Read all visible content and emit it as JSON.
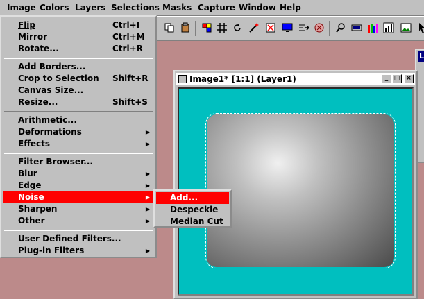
{
  "menubar": [
    {
      "label": "Image",
      "name": "menu-image",
      "active": true
    },
    {
      "label": "Colors",
      "name": "menu-colors"
    },
    {
      "label": "Layers",
      "name": "menu-layers"
    },
    {
      "label": "Selections",
      "name": "menu-selections"
    },
    {
      "label": "Masks",
      "name": "menu-masks"
    },
    {
      "label": "Capture",
      "name": "menu-capture"
    },
    {
      "label": "Window",
      "name": "menu-window"
    },
    {
      "label": "Help",
      "name": "menu-help"
    }
  ],
  "toolbar_icons": [
    "copy-icon",
    "paste-icon",
    "lock-icon",
    "palette-icon",
    "grid-icon",
    "rotate-icon",
    "dropper-icon",
    "magic-wand-icon",
    "monitor-icon",
    "arrow-export-icon",
    "circle-icon",
    "zoom-icon",
    "layers-icon",
    "histogram-icon",
    "chart-icon",
    "picture-icon"
  ],
  "image_menu": {
    "groups": [
      [
        {
          "label": "Flip",
          "shortcut": "Ctrl+I"
        },
        {
          "label": "Mirror",
          "shortcut": "Ctrl+M"
        },
        {
          "label": "Rotate...",
          "shortcut": "Ctrl+R"
        }
      ],
      [
        {
          "label": "Add Borders...",
          "shortcut": ""
        },
        {
          "label": "Crop to Selection",
          "shortcut": "Shift+R"
        },
        {
          "label": "Canvas Size...",
          "shortcut": ""
        },
        {
          "label": "Resize...",
          "shortcut": "Shift+S"
        }
      ],
      [
        {
          "label": "Arithmetic...",
          "shortcut": ""
        },
        {
          "label": "Deformations",
          "submenu": true
        },
        {
          "label": "Effects",
          "submenu": true
        }
      ],
      [
        {
          "label": "Filter Browser...",
          "shortcut": ""
        },
        {
          "label": "Blur",
          "submenu": true
        },
        {
          "label": "Edge",
          "submenu": true
        },
        {
          "label": "Noise",
          "submenu": true,
          "highlighted": true
        },
        {
          "label": "Sharpen",
          "submenu": true
        },
        {
          "label": "Other",
          "submenu": true
        }
      ],
      [
        {
          "label": "User Defined Filters...",
          "shortcut": ""
        },
        {
          "label": "Plug-in Filters",
          "submenu": true
        }
      ]
    ]
  },
  "noise_menu": [
    "Add...",
    "Despeckle",
    "Median Cut"
  ],
  "image_window": {
    "title": "Image1* [1:1] (Layer1)",
    "minimize": "_",
    "maximize": "□",
    "close": "×"
  },
  "win2": {
    "title": "L"
  },
  "colors": {
    "canvas": "#00bfbf",
    "highlight": "#ff0000",
    "desktop": "#bc8a8a"
  }
}
